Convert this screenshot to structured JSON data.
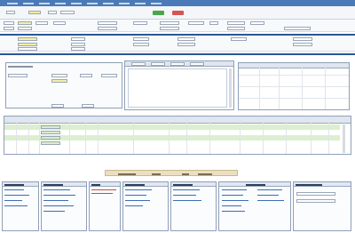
{
  "header": {
    "title": "",
    "save_label": "",
    "delete_label": ""
  },
  "colors": {
    "nav": "#4a7ab8",
    "save_button": "#4aa64a",
    "delete_button": "#d9534f",
    "highlight_field": "#f6efa3",
    "grid_row": "#dcefd0",
    "section_rule": "#2b5796"
  },
  "icons": [
    "save-icon",
    "delete-icon",
    "calendar-icon",
    "scroll-arrow-icon"
  ]
}
